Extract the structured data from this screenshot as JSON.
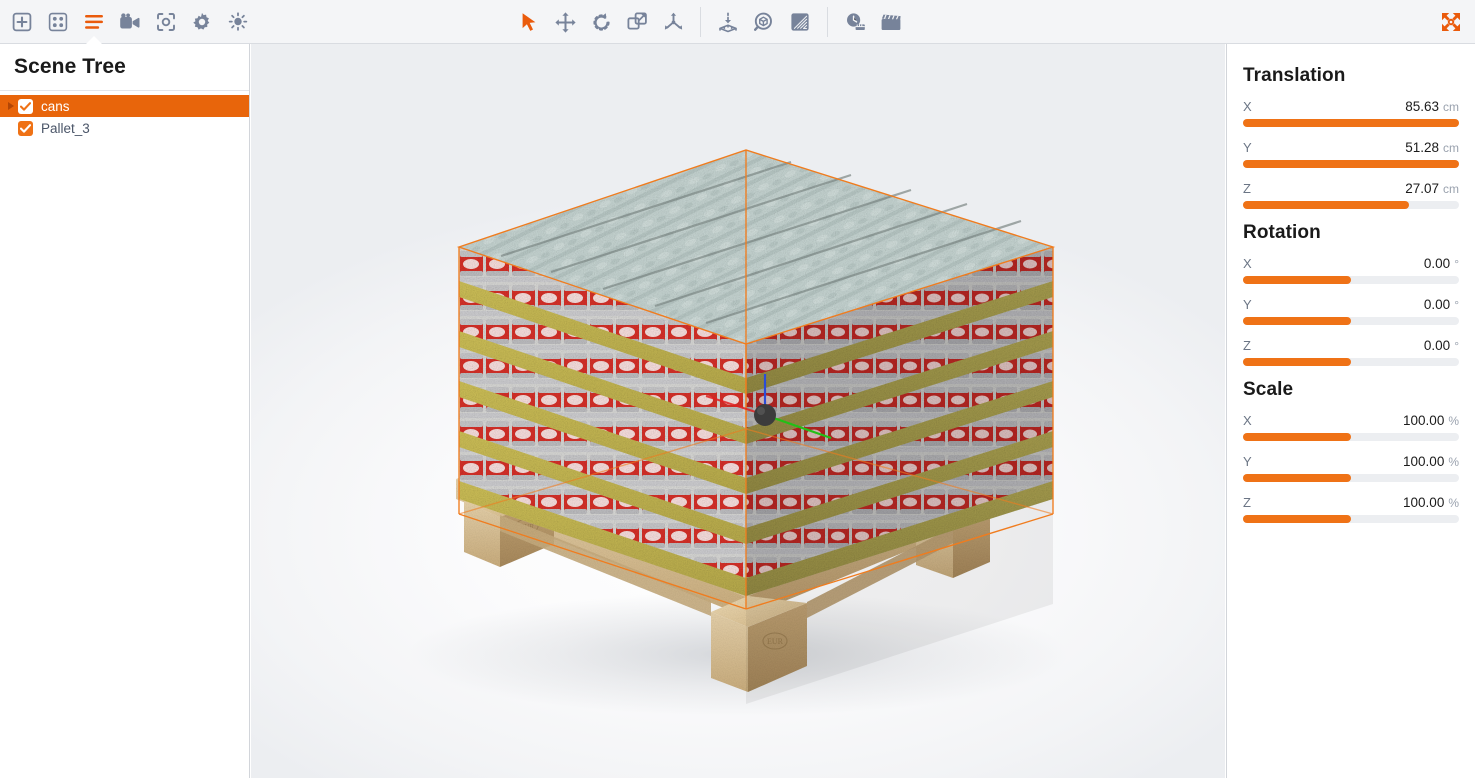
{
  "toolbar": {
    "left_buttons": [
      {
        "name": "add-object-button",
        "icon": "plus-box-icon",
        "label": "Add",
        "active": false
      },
      {
        "name": "pattern-layout-button",
        "icon": "grid-dots-icon",
        "label": "Pattern",
        "active": false
      },
      {
        "name": "scene-tree-button",
        "icon": "list-lines-icon",
        "label": "Scene Tree",
        "active": true
      },
      {
        "name": "camera-button",
        "icon": "video-camera-icon",
        "label": "Camera",
        "active": false
      },
      {
        "name": "snapshot-button",
        "icon": "viewfinder-icon",
        "label": "Snapshot",
        "active": false
      },
      {
        "name": "settings-button",
        "icon": "gear-icon",
        "label": "Settings",
        "active": false
      },
      {
        "name": "lighting-button",
        "icon": "light-bulb-icon",
        "label": "Lighting",
        "active": false
      }
    ],
    "center_groups": [
      [
        {
          "name": "select-tool-button",
          "icon": "cursor-arrow-icon",
          "label": "Select",
          "active": true
        },
        {
          "name": "move-tool-button",
          "icon": "move-arrows-icon",
          "label": "Move",
          "active": false
        },
        {
          "name": "rotate-tool-button",
          "icon": "rotate-arrow-icon",
          "label": "Rotate",
          "active": false
        },
        {
          "name": "scale-tool-button",
          "icon": "scale-corner-icon",
          "label": "Scale",
          "active": false
        },
        {
          "name": "explode-tool-button",
          "icon": "explode-arrows-icon",
          "label": "Explode",
          "active": false
        }
      ],
      [
        {
          "name": "drop-to-pallet-button",
          "icon": "drop-to-pallet-icon",
          "label": "Drop to Pallet",
          "active": false
        },
        {
          "name": "inspect-box-button",
          "icon": "box-magnifier-icon",
          "label": "Inspect",
          "active": false
        },
        {
          "name": "render-quality-button",
          "icon": "gradient-square-icon",
          "label": "Render Quality",
          "active": false
        }
      ],
      [
        {
          "name": "timeline-button",
          "icon": "clock-clapper-icon",
          "label": "Timeline",
          "active": false
        },
        {
          "name": "animation-button",
          "icon": "clapperboard-icon",
          "label": "Animation",
          "active": false
        }
      ]
    ],
    "right_buttons": [
      {
        "name": "fit-to-view-button",
        "icon": "expand-arrows-icon",
        "label": "Fit to View",
        "accent": true
      }
    ]
  },
  "sidebar": {
    "title": "Scene Tree",
    "items": [
      {
        "label": "cans",
        "checked": true,
        "selected": true,
        "expandable": true
      },
      {
        "label": "Pallet_3",
        "checked": true,
        "selected": false,
        "expandable": false
      }
    ]
  },
  "properties": {
    "sections": [
      {
        "title": "Translation",
        "rows": [
          {
            "axis": "X",
            "value": "85.63",
            "unit": "cm",
            "fill_pct": 100
          },
          {
            "axis": "Y",
            "value": "51.28",
            "unit": "cm",
            "fill_pct": 100
          },
          {
            "axis": "Z",
            "value": "27.07",
            "unit": "cm",
            "fill_pct": 77
          }
        ]
      },
      {
        "title": "Rotation",
        "rows": [
          {
            "axis": "X",
            "value": "0.00",
            "unit": "°",
            "fill_pct": 50
          },
          {
            "axis": "Y",
            "value": "0.00",
            "unit": "°",
            "fill_pct": 50
          },
          {
            "axis": "Z",
            "value": "0.00",
            "unit": "°",
            "fill_pct": 50
          }
        ]
      },
      {
        "title": "Scale",
        "rows": [
          {
            "axis": "X",
            "value": "100.00",
            "unit": "%",
            "fill_pct": 50
          },
          {
            "axis": "Y",
            "value": "100.00",
            "unit": "%",
            "fill_pct": 50
          },
          {
            "axis": "Z",
            "value": "100.00",
            "unit": "%",
            "fill_pct": 50
          }
        ]
      }
    ]
  },
  "viewport": {
    "scene_description": "Palletized load of shrink-wrapped cola can trays on a wooden EUR pallet, selected with an orange bounding box and a translate gizmo",
    "selection_box_color": "#f07c1e",
    "gizmo": {
      "x_axis_color": "#e02020",
      "y_axis_color": "#22c016",
      "z_axis_color": "#2b4cd8",
      "handle_color": "#3c3c3c"
    }
  },
  "colors": {
    "accent": "#ef7216",
    "accent_dark": "#e8650b",
    "toolbar_bg": "#f4f5f7",
    "icon": "#77839a",
    "track": "#eceef1"
  }
}
